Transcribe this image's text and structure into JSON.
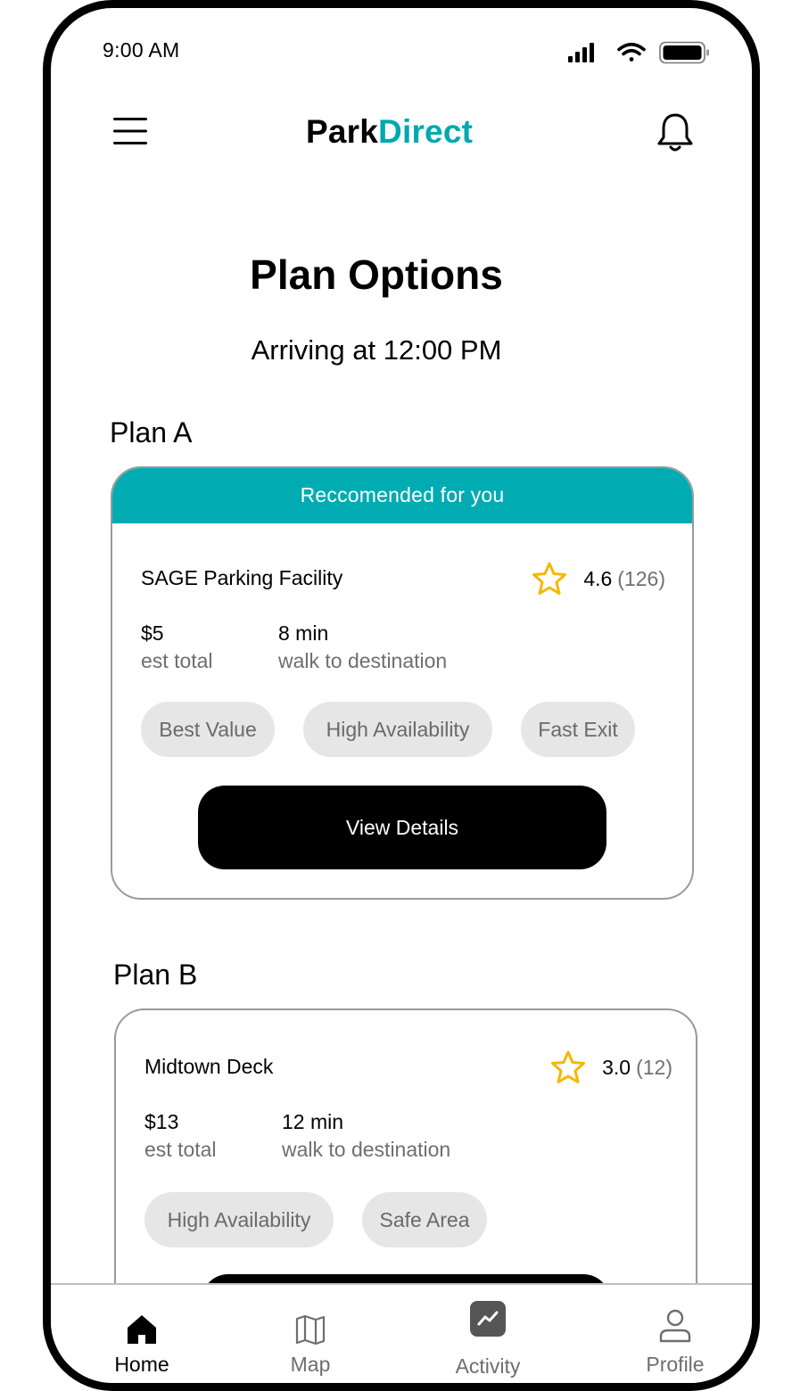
{
  "status_bar": {
    "time": "9:00 AM"
  },
  "header": {
    "brand_part1": "Park",
    "brand_part2": "Direct",
    "brand_color": "#00a8b0"
  },
  "page": {
    "title": "Plan Options",
    "subtitle": "Arriving at 12:00 PM"
  },
  "plans": [
    {
      "label": "Plan A",
      "banner": "Reccomended for you",
      "facility": "SAGE Parking Facility",
      "rating": "4.6",
      "reviews": "(126)",
      "price": "$5",
      "price_caption": "est total",
      "walk": "8 min",
      "walk_caption": "walk to destination",
      "tags": [
        "Best Value",
        "High Availability",
        "Fast Exit"
      ],
      "button": "View Details"
    },
    {
      "label": "Plan B",
      "facility": "Midtown Deck",
      "rating": "3.0",
      "reviews": "(12)",
      "price": "$13",
      "price_caption": "est total",
      "walk": "12 min",
      "walk_caption": "walk to destination",
      "tags": [
        "High Availability",
        "Safe Area"
      ]
    }
  ],
  "nav": {
    "items": [
      {
        "label": "Home",
        "icon": "home-icon",
        "active": true
      },
      {
        "label": "Map",
        "icon": "map-icon"
      },
      {
        "label": "Activity",
        "icon": "activity-icon"
      },
      {
        "label": "Profile",
        "icon": "profile-icon"
      }
    ]
  },
  "colors": {
    "accent": "#00acb2",
    "star": "#f5b800",
    "chip_bg": "#e6e6e6"
  }
}
